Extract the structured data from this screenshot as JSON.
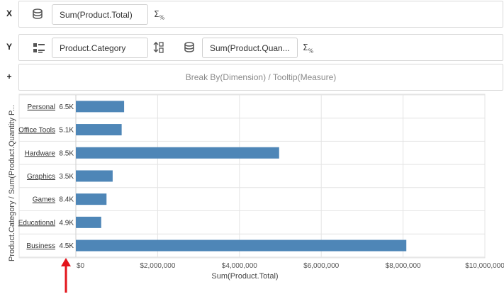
{
  "shelves": {
    "x": {
      "axis_label": "X",
      "measure": "Sum(Product.Total)",
      "measure_icon": "database-icon",
      "aggregate_icon": "sigma-percent-icon"
    },
    "y": {
      "axis_label": "Y",
      "dimension": "Product.Category",
      "dimension_icon": "list-icon",
      "sort_icon": "sort-icon",
      "measure": "Sum(Product.Quan...",
      "measure_icon": "database-icon",
      "aggregate_icon": "sigma-percent-icon"
    },
    "break": {
      "axis_label": "+",
      "placeholder": "Break By(Dimension) / Tooltip(Measure)"
    }
  },
  "chart_data": {
    "type": "bar",
    "orientation": "horizontal",
    "categories": [
      "Personal",
      "Office Tools",
      "Hardware",
      "Graphics",
      "Games",
      "Educational",
      "Business"
    ],
    "quantities": [
      "6.5K",
      "5.1K",
      "8.5K",
      "3.5K",
      "8.4K",
      "4.9K",
      "4.5K"
    ],
    "values": [
      1180000,
      1120000,
      4970000,
      900000,
      750000,
      620000,
      8080000
    ],
    "xlabel": "Sum(Product.Total)",
    "ylabel": "Product.Category / Sum(Product.Quantity P...",
    "xlim": [
      0,
      10000000
    ],
    "xticks": [
      "$0",
      "$2,000,000",
      "$4,000,000",
      "$6,000,000",
      "$8,000,000",
      "$10,000,000"
    ],
    "grid": true,
    "bar_color": "#4e86b7",
    "annotation_arrow_color": "#e3141b"
  }
}
